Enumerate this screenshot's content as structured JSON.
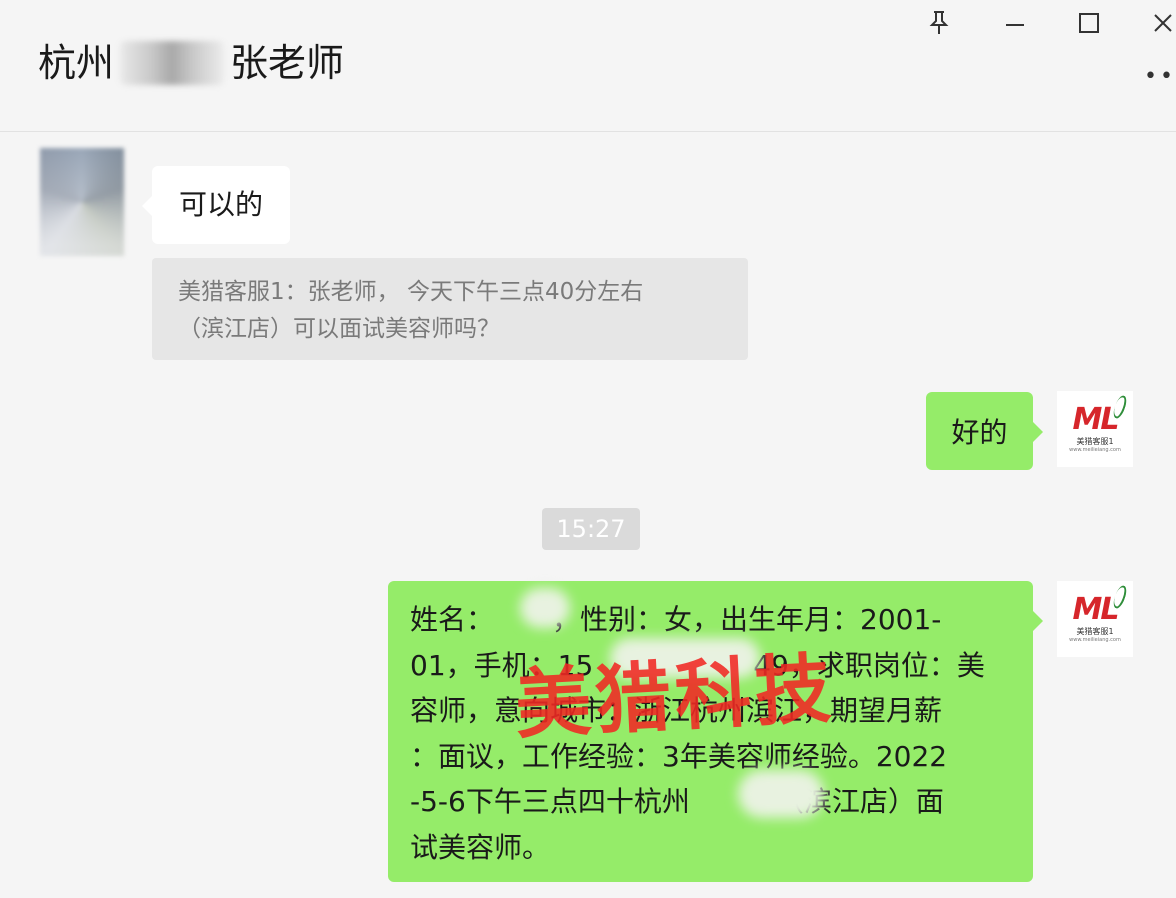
{
  "window": {
    "title_prefix": "杭州",
    "title_suffix": "张老师",
    "more": "•••"
  },
  "messages": {
    "incoming_text": "可以的",
    "quote_line1": "美猎客服1：张老师， 今天下午三点40分左右",
    "quote_line2": "（滨江店）可以面试美容师吗？",
    "ok_text": "好的",
    "time": "15:27",
    "info_lines": [
      "姓名：",
      "，性别：女，出生年月：2001-",
      "01，手机：15",
      "49，求职岗位：美",
      "容师，意向城市：浙江杭州滨江，期望月薪",
      "：面议，工作经验：3年美容师经验。2022",
      "-5-6下午三点四十杭州",
      "（滨江店）面",
      "试美容师。"
    ]
  },
  "avatar": {
    "mark": "ML",
    "name": "美猎客服1",
    "sub": "www.meilieiang.com"
  },
  "watermark": "美猎科技",
  "colors": {
    "green_bubble": "#95ec69",
    "watermark": "#f02823"
  }
}
